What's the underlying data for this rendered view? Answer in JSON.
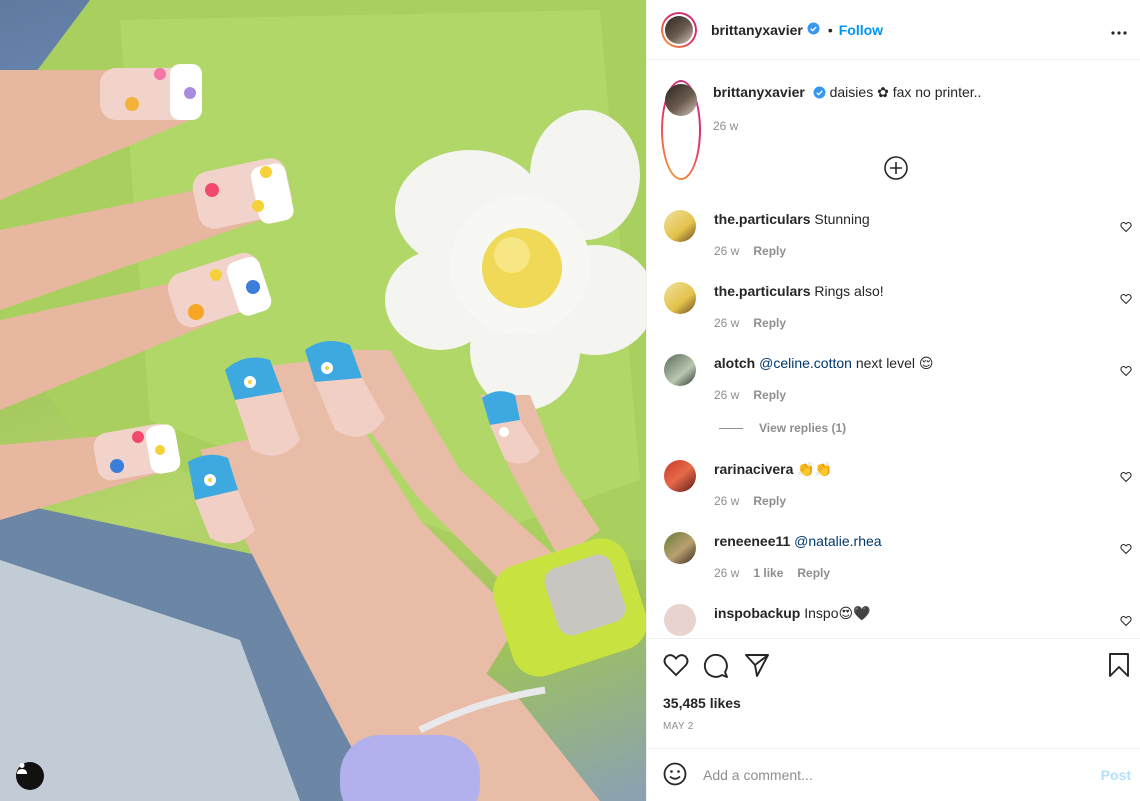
{
  "post": {
    "image_alt": "nails with daisies next to a white flower-shaped dish on a green tray",
    "author": "brittanyxavier",
    "follow_label": "Follow",
    "separator": "•",
    "caption": "daisies ✿ fax no printer..",
    "caption_time": "26 w",
    "likes": "35,485 likes",
    "date": "MAY 2"
  },
  "comments": [
    {
      "user": "the.particulars",
      "text": " Stunning",
      "mention": "",
      "time": "26 w",
      "likes": "",
      "reply": "Reply"
    },
    {
      "user": "the.particulars",
      "text": " Rings also!",
      "mention": "",
      "time": "26 w",
      "likes": "",
      "reply": "Reply"
    },
    {
      "user": "alotch",
      "mention": " @celine.cotton",
      "text": " next level 😌",
      "time": "26 w",
      "likes": "",
      "reply": "Reply"
    },
    {
      "user": "rarinacivera",
      "text": " 👏👏",
      "mention": "",
      "time": "26 w",
      "likes": "",
      "reply": "Reply"
    },
    {
      "user": "reneenee11",
      "mention": " @natalie.rhea",
      "text": "",
      "time": "26 w",
      "likes": "1 like",
      "reply": "Reply"
    },
    {
      "user": "inspobackup",
      "text": " Inspo😍🖤",
      "mention": "",
      "time": "",
      "likes": "",
      "reply": ""
    }
  ],
  "view_replies": "View replies (1)",
  "add_comment": {
    "placeholder": "Add a comment...",
    "post_label": "Post"
  },
  "icons": {
    "more": "more-options-icon",
    "load_more": "plus-circle-icon",
    "like": "heart-icon",
    "comment": "comment-icon",
    "share": "send-icon",
    "save": "bookmark-icon",
    "emoji": "emoji-icon",
    "tag": "user-tag-icon"
  },
  "colors": {
    "accent": "#0095f6",
    "mention": "#00376b",
    "muted": "#8e8e8e",
    "post_disabled": "#b2dffc"
  }
}
